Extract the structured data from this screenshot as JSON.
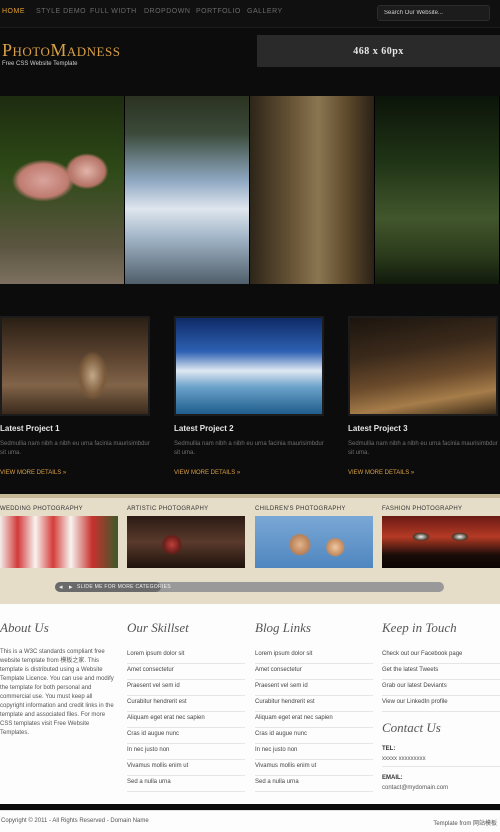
{
  "nav": {
    "items": [
      "HOME",
      "STYLE DEMO",
      "FULL WIDTH",
      "DROPDOWN",
      "PORTFOLIO",
      "GALLERY"
    ],
    "search_placeholder": "Search Our Website..."
  },
  "header": {
    "logo": "PhotoMadness",
    "tagline": "Free CSS Website Template",
    "ad_text": "468 x 60px"
  },
  "projects": [
    {
      "title": "Latest Project 1",
      "text": "Sedmullia nam nibh a nibh eu urna facinia maurisimbdur sit uma.",
      "more": "VIEW MORE DETAILS »"
    },
    {
      "title": "Latest Project 2",
      "text": "Sedmullia nam nibh a nibh eu urna facinia maurisimbdur sit uma.",
      "more": "VIEW MORE DETAILS »"
    },
    {
      "title": "Latest Project 3",
      "text": "Sedmullia nam nibh a nibh eu urna facinia maurisimbdur sit uma.",
      "more": "VIEW MORE DETAILS »"
    }
  ],
  "categories": {
    "items": [
      "WEDDING PHOTOGRAPHY",
      "ARTISTIC PHOTOGRAPHY",
      "CHILDREN'S PHOTOGRAPHY",
      "FASHION PHOTOGRAPHY"
    ],
    "slider_text": "SLIDE ME FOR MORE CATEGORIES",
    "slider_position": 0
  },
  "footer": {
    "about": {
      "title": "About Us",
      "text": "This is a W3C standards compliant free website template from 模板之家. This template is distributed using a Website Template Licence. You can use and modify the template for both personal and commercial use. You must keep all copyright information and credit links in the template and associated files. For more CSS templates visit Free Website Templates."
    },
    "skillset": {
      "title": "Our Skillset",
      "items": [
        "Lorem ipsum dolor sit",
        "Amet consectetur",
        "Praesent vel sem id",
        "Curabitur hendrerit est",
        "Aliquam eget erat nec sapien",
        "Cras id augue nunc",
        "In nec justo non",
        "Vivamus mollis enim ut",
        "Sed a nulla urna"
      ]
    },
    "blog": {
      "title": "Blog Links",
      "items": [
        "Lorem ipsum dolor sit",
        "Amet consectetur",
        "Praesent vel sem id",
        "Curabitur hendrerit est",
        "Aliquam eget erat nec sapien",
        "Cras id augue nunc",
        "In nec justo non",
        "Vivamus mollis enim ut",
        "Sed a nulla urna"
      ]
    },
    "touch": {
      "title": "Keep in Touch",
      "items": [
        "Check out our Facebook page",
        "Get the latest Tweets",
        "Grab our latest Deviants",
        "View our LinkedIn profile"
      ]
    },
    "contact": {
      "title": "Contact Us",
      "tel_label": "TEL:",
      "tel_value": "xxxxx xxxxxxxxx",
      "email_label": "EMAIL:",
      "email_value": "contact@mydomain.com"
    }
  },
  "bottom": {
    "copyright": "Copyright © 2011 - All Rights Reserved - Domain Name",
    "credit": "Template from 网站模板"
  }
}
